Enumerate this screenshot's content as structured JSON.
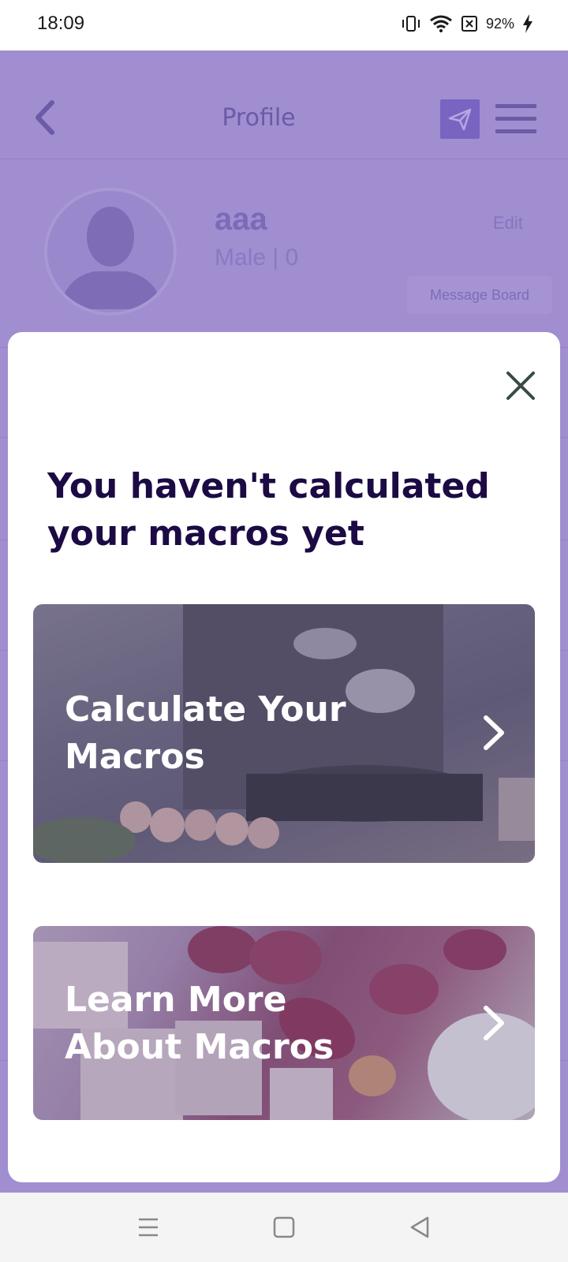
{
  "status_bar": {
    "time": "18:09",
    "battery": "92%"
  },
  "header": {
    "title": "Profile"
  },
  "profile": {
    "name": "aaa",
    "meta": "Male | 0",
    "edit_label": "Edit",
    "message_board_label": "Message Board"
  },
  "modal": {
    "title": "You haven't calculated your macros yet",
    "cards": [
      {
        "label": "Calculate Your Macros"
      },
      {
        "label": "Learn More About Macros"
      }
    ]
  },
  "colors": {
    "accent": "#a08ed0",
    "title_text": "#1c0a44",
    "close_icon": "#3a4a48"
  }
}
